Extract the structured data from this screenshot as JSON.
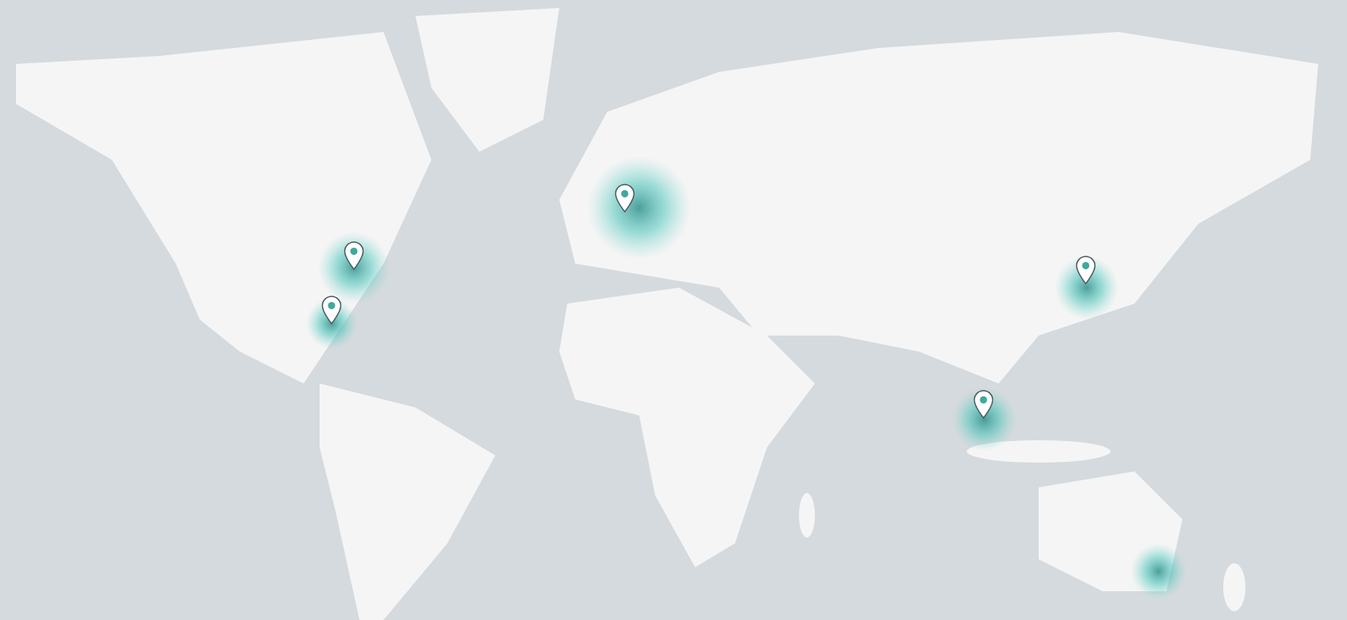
{
  "markers": [
    {
      "kind": "pin"
    },
    {
      "kind": "pin"
    },
    {
      "kind": "pin"
    },
    {
      "kind": "pin"
    },
    {
      "kind": "pin"
    }
  ]
}
